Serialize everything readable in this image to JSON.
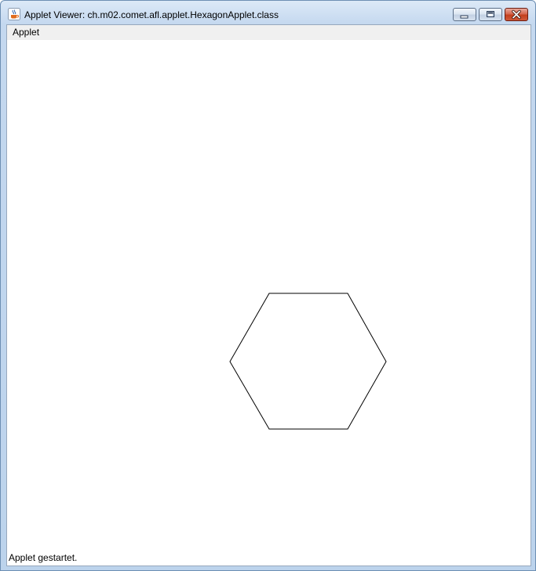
{
  "window": {
    "title": "Applet Viewer: ch.m02.comet.afl.applet.HexagonApplet.class",
    "icon": "java-cup-icon",
    "controls": {
      "minimize_icon": "minimize-icon",
      "maximize_icon": "maximize-icon",
      "close_icon": "close-icon",
      "close_color": "#c3401e"
    }
  },
  "menubar": {
    "items": [
      {
        "label": "Applet"
      }
    ]
  },
  "canvas": {
    "shape": "hexagon",
    "stroke_color": "#000000",
    "fill_color": "#ffffff"
  },
  "status": {
    "text": "Applet gestartet."
  }
}
